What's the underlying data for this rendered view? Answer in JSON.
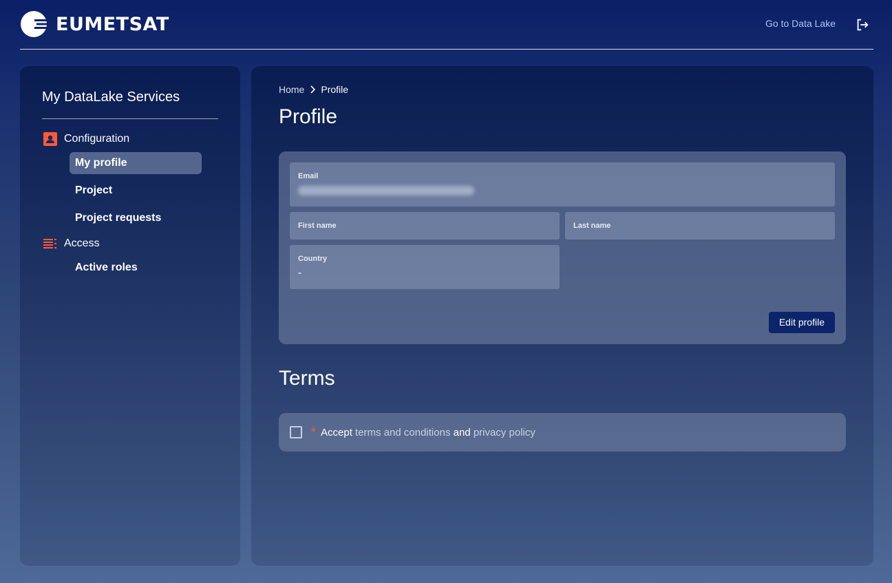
{
  "header": {
    "brand": "EUMETSAT",
    "datalake_link": "Go to Data Lake",
    "logout_icon": "logout-icon"
  },
  "sidebar": {
    "title": "My DataLake Services",
    "sections": [
      {
        "label": "Configuration",
        "icon": "contact-card-icon",
        "items": [
          {
            "label": "My profile",
            "active": true
          },
          {
            "label": "Project",
            "active": false
          },
          {
            "label": "Project requests",
            "active": false
          }
        ]
      },
      {
        "label": "Access",
        "icon": "list-icon",
        "items": [
          {
            "label": "Active roles",
            "active": false
          }
        ]
      }
    ]
  },
  "breadcrumb": {
    "home": "Home",
    "current": "Profile"
  },
  "page": {
    "title": "Profile"
  },
  "profile": {
    "email_label": "Email",
    "first_name_label": "First name",
    "last_name_label": "Last name",
    "country_label": "Country",
    "country_value": "-",
    "edit_button": "Edit profile"
  },
  "terms": {
    "title": "Terms",
    "required_marker": "*",
    "accept": "Accept",
    "terms_link": "terms and conditions",
    "and": "and",
    "privacy_link": "privacy policy",
    "checked": false
  },
  "colors": {
    "accent": "#ff5a36",
    "link": "#a9c6ff",
    "button": "#0b246a"
  }
}
